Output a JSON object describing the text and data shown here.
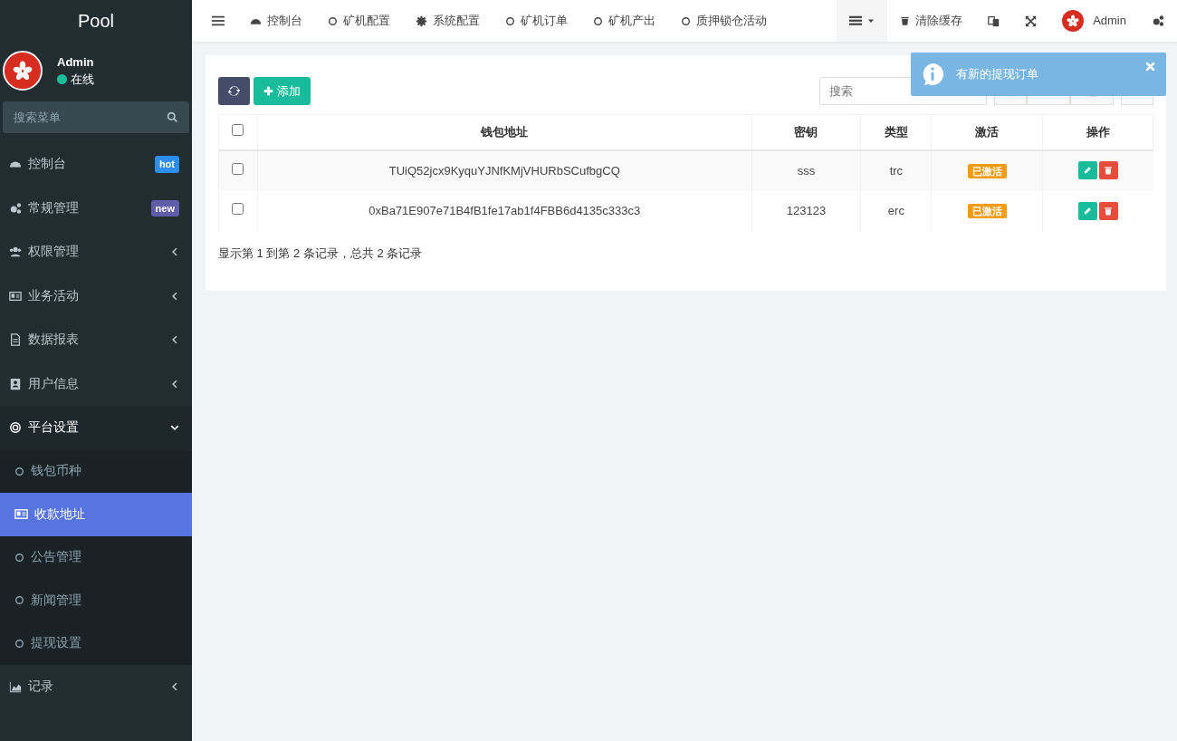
{
  "sidebar": {
    "brand": "Pool",
    "user": {
      "name": "Admin",
      "status": "在线",
      "online": true
    },
    "search": {
      "placeholder": "搜索菜单"
    },
    "items": [
      {
        "kind": "badge",
        "label": "控制台",
        "badge": {
          "text": "hot",
          "color": "#2c8ef0"
        }
      },
      {
        "kind": "badge",
        "label": "常规管理",
        "badge": {
          "text": "new",
          "color": "#605ca8"
        }
      },
      {
        "kind": "group",
        "label": "权限管理",
        "expanded": false
      },
      {
        "kind": "group",
        "label": "业务活动",
        "expanded": false
      },
      {
        "kind": "group",
        "label": "数据报表",
        "expanded": false
      },
      {
        "kind": "group",
        "label": "用户信息",
        "expanded": false
      },
      {
        "kind": "group",
        "label": "平台设置",
        "expanded": true,
        "children": [
          {
            "label": "钱包币种",
            "selected": false
          },
          {
            "label": "收款地址",
            "selected": true
          },
          {
            "label": "公告管理",
            "selected": false
          },
          {
            "label": "新闻管理",
            "selected": false
          },
          {
            "label": "提现设置",
            "selected": false
          }
        ]
      },
      {
        "kind": "group",
        "label": "记录",
        "expanded": false
      }
    ]
  },
  "topnav": {
    "tabs": [
      {
        "label": "控制台"
      },
      {
        "label": "矿机配置"
      },
      {
        "label": "系统配置"
      },
      {
        "label": "矿机订单"
      },
      {
        "label": "矿机产出"
      },
      {
        "label": "质押锁仓活动"
      }
    ],
    "clear_cache": "清除缓存",
    "user": "Admin"
  },
  "toolbar": {
    "add": "添加",
    "search": {
      "placeholder": "搜索"
    }
  },
  "table": {
    "columns": [
      "钱包地址",
      "密钥",
      "类型",
      "激活",
      "操作"
    ],
    "header_checked": false,
    "rows": [
      {
        "checked": false,
        "address": "TUiQ52jcx9KyquYJNfKMjVHURbSCufbgCQ",
        "key": "sss",
        "type": "trc",
        "status": "已激活"
      },
      {
        "checked": false,
        "address": "0xBa71E907e71B4fB1fe17ab1f4FBB6d4135c333c3",
        "key": "123123",
        "type": "erc",
        "status": "已激活"
      }
    ]
  },
  "pagination": "显示第 1 到第 2 条记录，总共 2 条记录",
  "toast": {
    "message": "有新的提现订单"
  }
}
